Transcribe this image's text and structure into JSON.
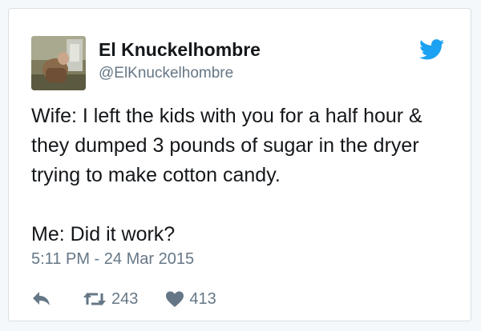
{
  "author": {
    "display_name": "El Knuckelhombre",
    "handle": "@ElKnuckelhombre"
  },
  "tweet": {
    "lines": [
      "Wife: I left the kids with you for a half hour &",
      "they dumped 3 pounds of sugar in the dryer",
      "trying to make cotton candy."
    ],
    "reply_line": "Me: Did it work?",
    "timestamp": "5:11 PM - 24 Mar 2015"
  },
  "stats": {
    "retweets": "243",
    "likes": "413"
  },
  "icons": {
    "brand": "twitter-bird-icon",
    "reply": "reply-icon",
    "retweet": "retweet-icon",
    "like": "heart-icon"
  },
  "colors": {
    "brand_blue": "#1da1f2",
    "text": "#14171a",
    "secondary": "#657786"
  }
}
